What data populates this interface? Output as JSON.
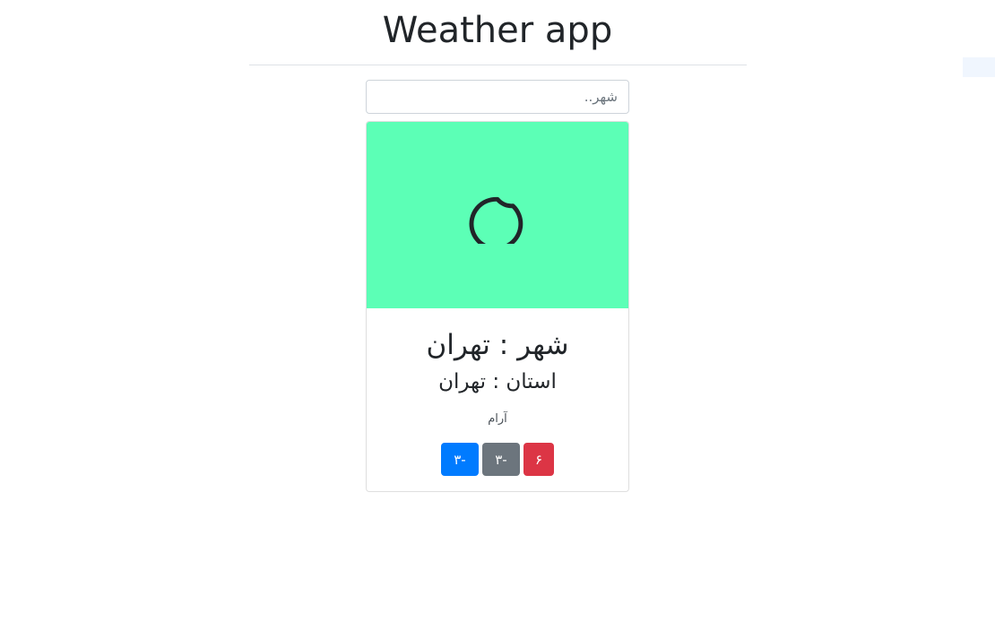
{
  "header": {
    "title": "Weather app"
  },
  "search": {
    "placeholder": "شهر..",
    "value": ""
  },
  "card": {
    "image_bg": "#5cffb6",
    "icon": "moon-icon",
    "city": "شهر : تهران",
    "province": "استان : تهران",
    "description": "آرام",
    "temperatures": {
      "blue": "۳-",
      "gray": "۳-",
      "red": "۶"
    }
  },
  "colors": {
    "blue": "#007bff",
    "gray": "#6c757d",
    "red": "#dc3545"
  }
}
